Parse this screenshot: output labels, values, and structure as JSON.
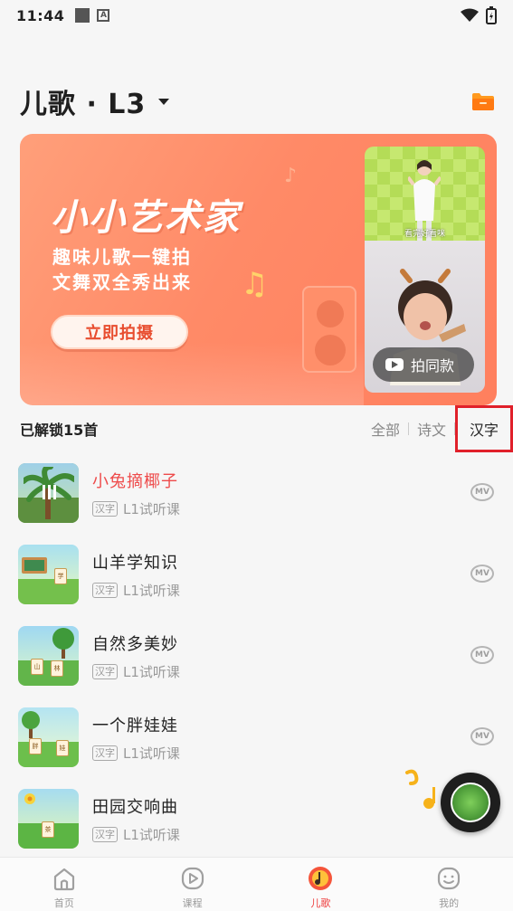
{
  "status_bar": {
    "time": "11:44",
    "a_badge": "A"
  },
  "header": {
    "title": "儿歌 · L3",
    "folder_icon": "folder-icon"
  },
  "banner": {
    "headline": "小小艺术家",
    "line1": "趣味儿歌一键拍",
    "line2": "文舞双全秀出来",
    "cta_label": "立即拍摄",
    "video_caption": "看完好看咪",
    "same_style_label": "拍同款"
  },
  "filter": {
    "unlocked_text": "已解锁15首",
    "tabs": [
      {
        "label": "全部",
        "active": false
      },
      {
        "label": "诗文",
        "active": false
      },
      {
        "label": "汉字",
        "active": true
      }
    ]
  },
  "songs": [
    {
      "name": "小兔摘椰子",
      "tag": "汉字",
      "level": "L1试听课",
      "playing": true,
      "mv": "MV"
    },
    {
      "name": "山羊学知识",
      "tag": "汉字",
      "level": "L1试听课",
      "playing": false,
      "mv": "MV"
    },
    {
      "name": "自然多美妙",
      "tag": "汉字",
      "level": "L1试听课",
      "playing": false,
      "mv": "MV"
    },
    {
      "name": "一个胖娃娃",
      "tag": "汉字",
      "level": "L1试听课",
      "playing": false,
      "mv": "MV"
    },
    {
      "name": "田园交响曲",
      "tag": "汉字",
      "level": "L1试听课",
      "playing": false,
      "mv": "MV"
    }
  ],
  "thumb_card_chars": {
    "s2": "学",
    "s3a": "山",
    "s3b": "林",
    "s4a": "胖",
    "s4b": "娃",
    "s5": "茶"
  },
  "bottom_nav": [
    {
      "label": "首页",
      "icon": "home-icon",
      "active": false
    },
    {
      "label": "课程",
      "icon": "play-circle-icon",
      "active": false
    },
    {
      "label": "儿歌",
      "icon": "music-disc-icon",
      "active": true
    },
    {
      "label": "我的",
      "icon": "smile-face-icon",
      "active": false
    }
  ],
  "colors": {
    "accent": "#ee3b3b",
    "banner": "#ff8a67",
    "highlight_box": "#e0202a"
  }
}
